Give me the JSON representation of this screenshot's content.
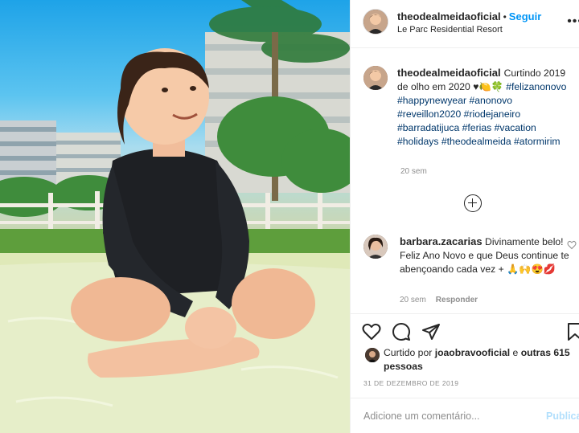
{
  "post": {
    "username": "theodealmeidaoficial",
    "follow_label": "Seguir",
    "separator": "•",
    "location": "Le Parc Residential Resort",
    "more_icon": "more-icon",
    "caption": {
      "text": "Curtindo 2019 de olho em 2020",
      "emojis": "♥🍋🍀",
      "hashtags": [
        "#felizanonovo",
        "#happynewyear",
        "#anonovo",
        "#reveillon2020",
        "#riodejaneiro",
        "#barradatijuca",
        "#ferias",
        "#vacation",
        "#holidays",
        "#theodealmeida",
        "#atormirim"
      ],
      "time": "20 sem"
    },
    "load_more_icon": "plus-circle-icon",
    "comment": {
      "username": "barbara.zacarias",
      "text": "Divinamente belo! Feliz Ano Novo e que Deus continue te abençoando cada vez +",
      "emojis": "🙏🙌😍💋",
      "time": "20 sem",
      "reply_label": "Responder"
    },
    "likes": {
      "prefix": "Curtido por",
      "user": "joaobravooficial",
      "connector": "e",
      "others": "outras 615 pessoas"
    },
    "date": "31 DE DEZEMBRO DE 2019",
    "add_comment_placeholder": "Adicione um comentário...",
    "publish_label": "Publicar"
  },
  "colors": {
    "link": "#00376b",
    "follow": "#0095f6",
    "muted": "#8e8e8e",
    "publish_disabled": "#b2dffc"
  }
}
